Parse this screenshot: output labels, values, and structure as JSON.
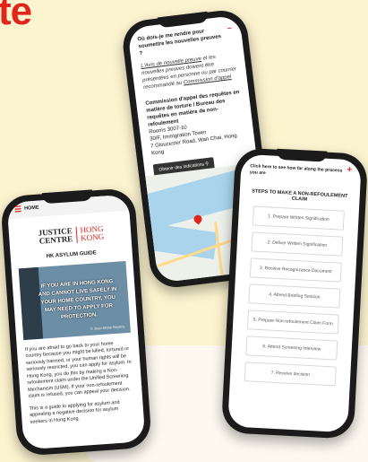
{
  "headline": "te",
  "phone_b": {
    "question": "Où dois-je me rendre pour soumettre les nouvelles preuves ?",
    "toggle": "–",
    "answer_pre": "",
    "answer_link": "L'Avis de nouvelle preuve",
    "answer_mid": " et les nouvelles preuves doivent être présentées en personne ou par courrier recommandé au ",
    "answer_link2": "Commission d'appel",
    "addr_title": "Commission d'appel des requêtes en matière de torture / Bureau des requêtes en matière de non-refoulement",
    "addr_lines": [
      "Rooms 3007-10",
      "30/F, Immigration Tower",
      "7 Gloucester Road, Wan Chai, Hong Kong"
    ],
    "map_button": "Obtenir des indications"
  },
  "phone_c": {
    "header": "Click here to see how far along the process you are",
    "close": "+",
    "title": "STEPS TO MAKE A NON-REFOULEMENT CLAIM",
    "steps": [
      "1. Prepare Written Signification",
      "2. Deliver Written Signification",
      "3. Receive Recognizance Document",
      "4. Attend Briefing Session",
      "5. Prepare Non-refoulement Claim Form",
      "6. Attend Screening Interview",
      "7. Receive decision"
    ]
  },
  "phone_a": {
    "nav": "HOME",
    "logo_left": "JUSTICE CENTRE",
    "logo_right": "HONG KONG",
    "guide_title": "HK ASYLUM GUIDE",
    "hero_text": "IF YOU ARE IN HONG KONG AND CANNOT LIVE SAFELY IN YOUR HOME COUNTRY, YOU MAY NEED TO APPLY FOR PROTECTION.",
    "hero_credit": "© Jean-Marie Beyens",
    "para1": "If you are afraid to go back to your home country because you might be killed, tortured or seriously harmed, or your human rights will be seriously restricted, you can apply for asylum. In Hong Kong, you do this by making a Non-refoulement claim under the Unified Screening Mechanism (USM). If your non-refoulement claim is refused, you can appeal your decision.",
    "para2": "This is a guide to applying for asylum and appealing a negative decision for asylum seekers in Hong Kong."
  },
  "colors": {
    "accent": "#e1261c",
    "background": "#fcf3cf"
  }
}
